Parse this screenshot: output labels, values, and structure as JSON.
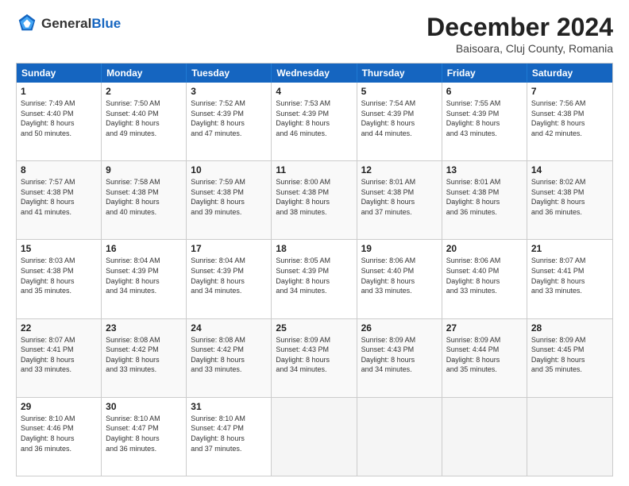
{
  "header": {
    "logo": {
      "general": "General",
      "blue": "Blue"
    },
    "title": "December 2024",
    "subtitle": "Baisoara, Cluj County, Romania"
  },
  "calendar": {
    "days": [
      "Sunday",
      "Monday",
      "Tuesday",
      "Wednesday",
      "Thursday",
      "Friday",
      "Saturday"
    ],
    "rows": [
      [
        {
          "day": "1",
          "info": "Sunrise: 7:49 AM\nSunset: 4:40 PM\nDaylight: 8 hours\nand 50 minutes."
        },
        {
          "day": "2",
          "info": "Sunrise: 7:50 AM\nSunset: 4:40 PM\nDaylight: 8 hours\nand 49 minutes."
        },
        {
          "day": "3",
          "info": "Sunrise: 7:52 AM\nSunset: 4:39 PM\nDaylight: 8 hours\nand 47 minutes."
        },
        {
          "day": "4",
          "info": "Sunrise: 7:53 AM\nSunset: 4:39 PM\nDaylight: 8 hours\nand 46 minutes."
        },
        {
          "day": "5",
          "info": "Sunrise: 7:54 AM\nSunset: 4:39 PM\nDaylight: 8 hours\nand 44 minutes."
        },
        {
          "day": "6",
          "info": "Sunrise: 7:55 AM\nSunset: 4:39 PM\nDaylight: 8 hours\nand 43 minutes."
        },
        {
          "day": "7",
          "info": "Sunrise: 7:56 AM\nSunset: 4:38 PM\nDaylight: 8 hours\nand 42 minutes."
        }
      ],
      [
        {
          "day": "8",
          "info": "Sunrise: 7:57 AM\nSunset: 4:38 PM\nDaylight: 8 hours\nand 41 minutes."
        },
        {
          "day": "9",
          "info": "Sunrise: 7:58 AM\nSunset: 4:38 PM\nDaylight: 8 hours\nand 40 minutes."
        },
        {
          "day": "10",
          "info": "Sunrise: 7:59 AM\nSunset: 4:38 PM\nDaylight: 8 hours\nand 39 minutes."
        },
        {
          "day": "11",
          "info": "Sunrise: 8:00 AM\nSunset: 4:38 PM\nDaylight: 8 hours\nand 38 minutes."
        },
        {
          "day": "12",
          "info": "Sunrise: 8:01 AM\nSunset: 4:38 PM\nDaylight: 8 hours\nand 37 minutes."
        },
        {
          "day": "13",
          "info": "Sunrise: 8:01 AM\nSunset: 4:38 PM\nDaylight: 8 hours\nand 36 minutes."
        },
        {
          "day": "14",
          "info": "Sunrise: 8:02 AM\nSunset: 4:38 PM\nDaylight: 8 hours\nand 36 minutes."
        }
      ],
      [
        {
          "day": "15",
          "info": "Sunrise: 8:03 AM\nSunset: 4:38 PM\nDaylight: 8 hours\nand 35 minutes."
        },
        {
          "day": "16",
          "info": "Sunrise: 8:04 AM\nSunset: 4:39 PM\nDaylight: 8 hours\nand 34 minutes."
        },
        {
          "day": "17",
          "info": "Sunrise: 8:04 AM\nSunset: 4:39 PM\nDaylight: 8 hours\nand 34 minutes."
        },
        {
          "day": "18",
          "info": "Sunrise: 8:05 AM\nSunset: 4:39 PM\nDaylight: 8 hours\nand 34 minutes."
        },
        {
          "day": "19",
          "info": "Sunrise: 8:06 AM\nSunset: 4:40 PM\nDaylight: 8 hours\nand 33 minutes."
        },
        {
          "day": "20",
          "info": "Sunrise: 8:06 AM\nSunset: 4:40 PM\nDaylight: 8 hours\nand 33 minutes."
        },
        {
          "day": "21",
          "info": "Sunrise: 8:07 AM\nSunset: 4:41 PM\nDaylight: 8 hours\nand 33 minutes."
        }
      ],
      [
        {
          "day": "22",
          "info": "Sunrise: 8:07 AM\nSunset: 4:41 PM\nDaylight: 8 hours\nand 33 minutes."
        },
        {
          "day": "23",
          "info": "Sunrise: 8:08 AM\nSunset: 4:42 PM\nDaylight: 8 hours\nand 33 minutes."
        },
        {
          "day": "24",
          "info": "Sunrise: 8:08 AM\nSunset: 4:42 PM\nDaylight: 8 hours\nand 33 minutes."
        },
        {
          "day": "25",
          "info": "Sunrise: 8:09 AM\nSunset: 4:43 PM\nDaylight: 8 hours\nand 34 minutes."
        },
        {
          "day": "26",
          "info": "Sunrise: 8:09 AM\nSunset: 4:43 PM\nDaylight: 8 hours\nand 34 minutes."
        },
        {
          "day": "27",
          "info": "Sunrise: 8:09 AM\nSunset: 4:44 PM\nDaylight: 8 hours\nand 35 minutes."
        },
        {
          "day": "28",
          "info": "Sunrise: 8:09 AM\nSunset: 4:45 PM\nDaylight: 8 hours\nand 35 minutes."
        }
      ],
      [
        {
          "day": "29",
          "info": "Sunrise: 8:10 AM\nSunset: 4:46 PM\nDaylight: 8 hours\nand 36 minutes."
        },
        {
          "day": "30",
          "info": "Sunrise: 8:10 AM\nSunset: 4:47 PM\nDaylight: 8 hours\nand 36 minutes."
        },
        {
          "day": "31",
          "info": "Sunrise: 8:10 AM\nSunset: 4:47 PM\nDaylight: 8 hours\nand 37 minutes."
        },
        {
          "day": "",
          "info": ""
        },
        {
          "day": "",
          "info": ""
        },
        {
          "day": "",
          "info": ""
        },
        {
          "day": "",
          "info": ""
        }
      ]
    ]
  }
}
